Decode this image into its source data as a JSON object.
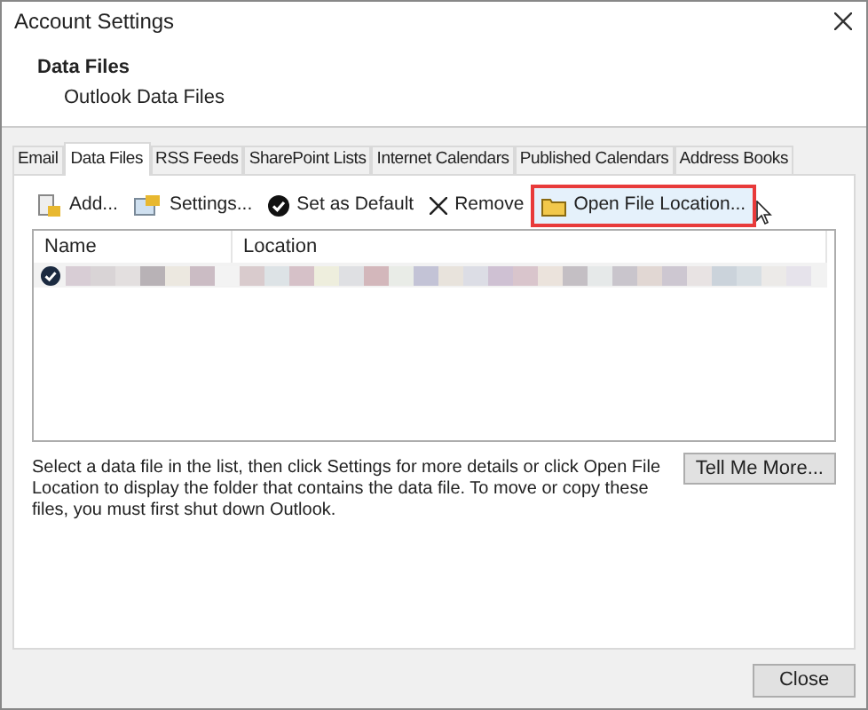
{
  "window": {
    "title": "Account Settings"
  },
  "header": {
    "title": "Data Files",
    "subtitle": "Outlook Data Files"
  },
  "tabs": [
    {
      "label": "Email",
      "selected": false
    },
    {
      "label": "Data Files",
      "selected": true
    },
    {
      "label": "RSS Feeds",
      "selected": false
    },
    {
      "label": "SharePoint Lists",
      "selected": false
    },
    {
      "label": "Internet Calendars",
      "selected": false
    },
    {
      "label": "Published Calendars",
      "selected": false
    },
    {
      "label": "Address Books",
      "selected": false
    }
  ],
  "toolbar": [
    {
      "kind": "add",
      "label": "Add...",
      "highlighted": false
    },
    {
      "kind": "settings",
      "label": "Settings...",
      "highlighted": false
    },
    {
      "kind": "default",
      "label": "Set as Default",
      "highlighted": false
    },
    {
      "kind": "remove",
      "label": "Remove",
      "highlighted": false
    },
    {
      "kind": "folder",
      "label": "Open File Location...",
      "highlighted": true
    }
  ],
  "table": {
    "columns": [
      "Name",
      "Location"
    ],
    "rows": [
      {
        "default": true,
        "selected": true
      }
    ]
  },
  "help_text": "Select a data file in the list, then click Settings for more details or click Open File Location to display the folder that contains the data file. To move or copy these files, you must first shut down Outlook.",
  "help_button": "Tell Me More...",
  "close_button": "Close"
}
